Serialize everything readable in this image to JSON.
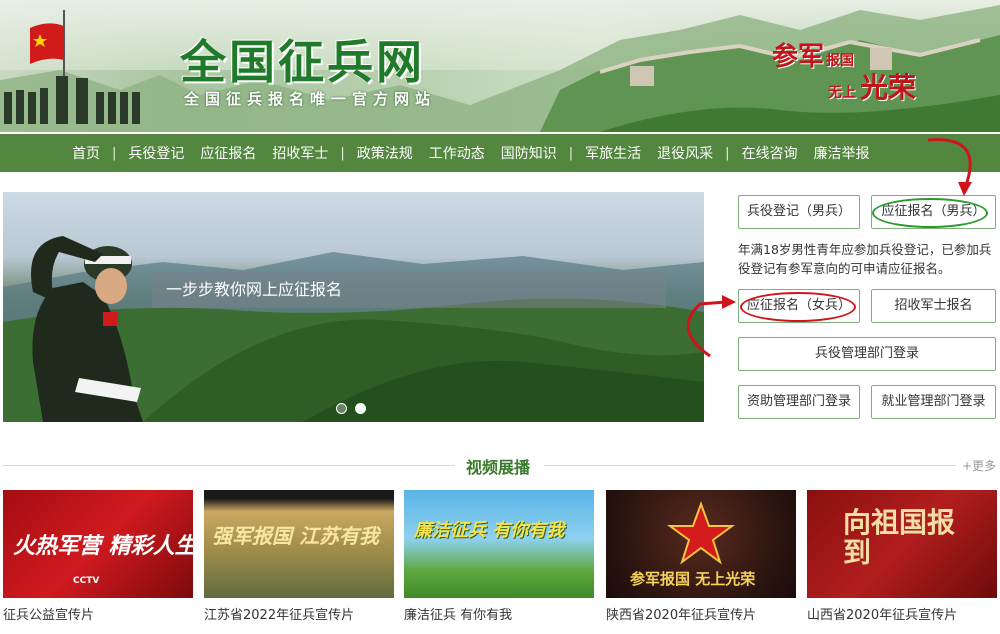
{
  "banner": {
    "title": "全国征兵网",
    "subtitle": "全国征兵报名唯一官方网站",
    "slogan_a": "参军",
    "slogan_b": "报国",
    "slogan_c": "无上",
    "slogan_d": "光荣"
  },
  "nav": {
    "items": [
      "首页",
      "兵役登记",
      "应征报名",
      "招收军士",
      "政策法规",
      "工作动态",
      "国防知识",
      "军旅生活",
      "退役风采",
      "在线咨询",
      "廉洁举报"
    ],
    "separator": "|"
  },
  "hero": {
    "caption": "一步步教你网上应征报名",
    "slides": 2,
    "active_slide": 2
  },
  "right_panel": {
    "btn_register_male": "兵役登记（男兵）",
    "btn_enlist_male": "应征报名（男兵）",
    "description": "年满18岁男性青年应参加兵役登记，已参加兵役登记有参军意向的可申请应征报名。",
    "btn_enlist_female": "应征报名（女兵）",
    "btn_nco": "招收军士报名",
    "btn_admin_login": "兵役管理部门登录",
    "btn_aid_login": "资助管理部门登录",
    "btn_employ_login": "就业管理部门登录"
  },
  "videos": {
    "section_title": "视频展播",
    "more": "+更多",
    "items": [
      {
        "caption": "征兵公益宣传片",
        "art": "火热军营 精彩人生",
        "sub": "CCTV"
      },
      {
        "caption": "江苏省2022年征兵宣传片",
        "art": "强军报国 江苏有我",
        "sub": ""
      },
      {
        "caption": "廉洁征兵 有你有我",
        "art": "廉洁征兵 有你有我",
        "sub": ""
      },
      {
        "caption": "陕西省2020年征兵宣传片",
        "art": "参军报国 无上光荣",
        "sub": ""
      },
      {
        "caption": "山西省2020年征兵宣传片",
        "art": "向祖国报到",
        "sub": ""
      }
    ]
  },
  "colors": {
    "nav_green": "#53873f",
    "title_green": "#1f7a2a",
    "annotation_red": "#d0141c",
    "annotation_green": "#2a9a2a"
  }
}
